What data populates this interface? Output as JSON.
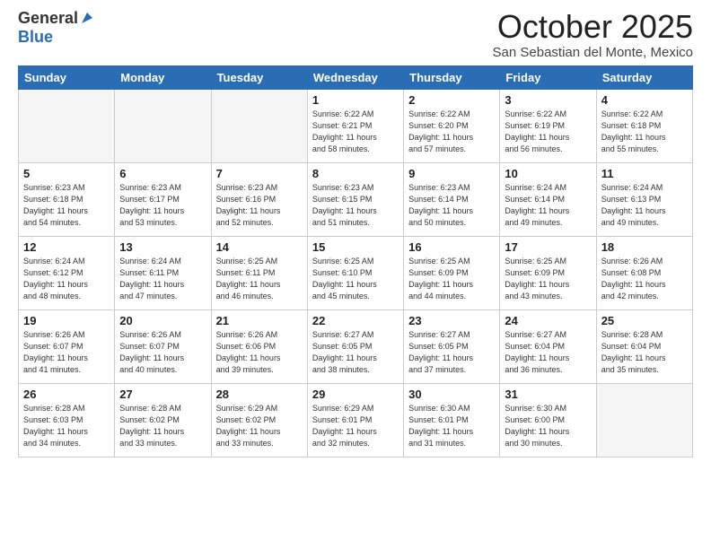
{
  "logo": {
    "general": "General",
    "blue": "Blue"
  },
  "header": {
    "month": "October 2025",
    "location": "San Sebastian del Monte, Mexico"
  },
  "days_of_week": [
    "Sunday",
    "Monday",
    "Tuesday",
    "Wednesday",
    "Thursday",
    "Friday",
    "Saturday"
  ],
  "weeks": [
    [
      {
        "day": "",
        "info": ""
      },
      {
        "day": "",
        "info": ""
      },
      {
        "day": "",
        "info": ""
      },
      {
        "day": "1",
        "info": "Sunrise: 6:22 AM\nSunset: 6:21 PM\nDaylight: 11 hours\nand 58 minutes."
      },
      {
        "day": "2",
        "info": "Sunrise: 6:22 AM\nSunset: 6:20 PM\nDaylight: 11 hours\nand 57 minutes."
      },
      {
        "day": "3",
        "info": "Sunrise: 6:22 AM\nSunset: 6:19 PM\nDaylight: 11 hours\nand 56 minutes."
      },
      {
        "day": "4",
        "info": "Sunrise: 6:22 AM\nSunset: 6:18 PM\nDaylight: 11 hours\nand 55 minutes."
      }
    ],
    [
      {
        "day": "5",
        "info": "Sunrise: 6:23 AM\nSunset: 6:18 PM\nDaylight: 11 hours\nand 54 minutes."
      },
      {
        "day": "6",
        "info": "Sunrise: 6:23 AM\nSunset: 6:17 PM\nDaylight: 11 hours\nand 53 minutes."
      },
      {
        "day": "7",
        "info": "Sunrise: 6:23 AM\nSunset: 6:16 PM\nDaylight: 11 hours\nand 52 minutes."
      },
      {
        "day": "8",
        "info": "Sunrise: 6:23 AM\nSunset: 6:15 PM\nDaylight: 11 hours\nand 51 minutes."
      },
      {
        "day": "9",
        "info": "Sunrise: 6:23 AM\nSunset: 6:14 PM\nDaylight: 11 hours\nand 50 minutes."
      },
      {
        "day": "10",
        "info": "Sunrise: 6:24 AM\nSunset: 6:14 PM\nDaylight: 11 hours\nand 49 minutes."
      },
      {
        "day": "11",
        "info": "Sunrise: 6:24 AM\nSunset: 6:13 PM\nDaylight: 11 hours\nand 49 minutes."
      }
    ],
    [
      {
        "day": "12",
        "info": "Sunrise: 6:24 AM\nSunset: 6:12 PM\nDaylight: 11 hours\nand 48 minutes."
      },
      {
        "day": "13",
        "info": "Sunrise: 6:24 AM\nSunset: 6:11 PM\nDaylight: 11 hours\nand 47 minutes."
      },
      {
        "day": "14",
        "info": "Sunrise: 6:25 AM\nSunset: 6:11 PM\nDaylight: 11 hours\nand 46 minutes."
      },
      {
        "day": "15",
        "info": "Sunrise: 6:25 AM\nSunset: 6:10 PM\nDaylight: 11 hours\nand 45 minutes."
      },
      {
        "day": "16",
        "info": "Sunrise: 6:25 AM\nSunset: 6:09 PM\nDaylight: 11 hours\nand 44 minutes."
      },
      {
        "day": "17",
        "info": "Sunrise: 6:25 AM\nSunset: 6:09 PM\nDaylight: 11 hours\nand 43 minutes."
      },
      {
        "day": "18",
        "info": "Sunrise: 6:26 AM\nSunset: 6:08 PM\nDaylight: 11 hours\nand 42 minutes."
      }
    ],
    [
      {
        "day": "19",
        "info": "Sunrise: 6:26 AM\nSunset: 6:07 PM\nDaylight: 11 hours\nand 41 minutes."
      },
      {
        "day": "20",
        "info": "Sunrise: 6:26 AM\nSunset: 6:07 PM\nDaylight: 11 hours\nand 40 minutes."
      },
      {
        "day": "21",
        "info": "Sunrise: 6:26 AM\nSunset: 6:06 PM\nDaylight: 11 hours\nand 39 minutes."
      },
      {
        "day": "22",
        "info": "Sunrise: 6:27 AM\nSunset: 6:05 PM\nDaylight: 11 hours\nand 38 minutes."
      },
      {
        "day": "23",
        "info": "Sunrise: 6:27 AM\nSunset: 6:05 PM\nDaylight: 11 hours\nand 37 minutes."
      },
      {
        "day": "24",
        "info": "Sunrise: 6:27 AM\nSunset: 6:04 PM\nDaylight: 11 hours\nand 36 minutes."
      },
      {
        "day": "25",
        "info": "Sunrise: 6:28 AM\nSunset: 6:04 PM\nDaylight: 11 hours\nand 35 minutes."
      }
    ],
    [
      {
        "day": "26",
        "info": "Sunrise: 6:28 AM\nSunset: 6:03 PM\nDaylight: 11 hours\nand 34 minutes."
      },
      {
        "day": "27",
        "info": "Sunrise: 6:28 AM\nSunset: 6:02 PM\nDaylight: 11 hours\nand 33 minutes."
      },
      {
        "day": "28",
        "info": "Sunrise: 6:29 AM\nSunset: 6:02 PM\nDaylight: 11 hours\nand 33 minutes."
      },
      {
        "day": "29",
        "info": "Sunrise: 6:29 AM\nSunset: 6:01 PM\nDaylight: 11 hours\nand 32 minutes."
      },
      {
        "day": "30",
        "info": "Sunrise: 6:30 AM\nSunset: 6:01 PM\nDaylight: 11 hours\nand 31 minutes."
      },
      {
        "day": "31",
        "info": "Sunrise: 6:30 AM\nSunset: 6:00 PM\nDaylight: 11 hours\nand 30 minutes."
      },
      {
        "day": "",
        "info": ""
      }
    ]
  ]
}
